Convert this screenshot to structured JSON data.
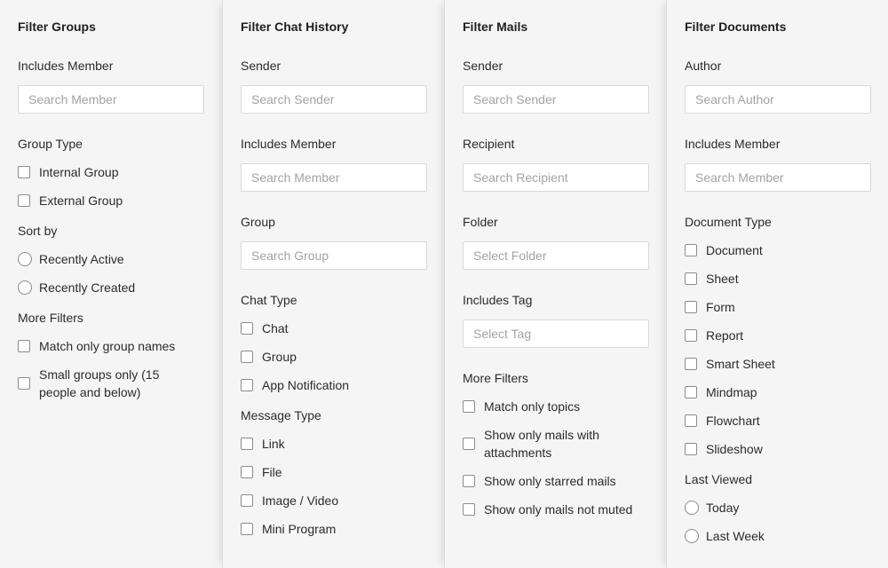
{
  "groups": {
    "title": "Filter Groups",
    "member_label": "Includes Member",
    "member_placeholder": "Search Member",
    "type_label": "Group Type",
    "type_options": [
      "Internal Group",
      "External Group"
    ],
    "sort_label": "Sort by",
    "sort_options": [
      "Recently Active",
      "Recently Created"
    ],
    "more_label": "More Filters",
    "more_options": [
      "Match only group names",
      "Small groups only (15 people and below)"
    ]
  },
  "chat": {
    "title": "Filter Chat History",
    "sender_label": "Sender",
    "sender_placeholder": "Search Sender",
    "member_label": "Includes Member",
    "member_placeholder": "Search Member",
    "group_label": "Group",
    "group_placeholder": "Search Group",
    "chat_type_label": "Chat Type",
    "chat_type_options": [
      "Chat",
      "Group",
      "App Notification"
    ],
    "message_type_label": "Message Type",
    "message_type_options": [
      "Link",
      "File",
      "Image / Video",
      "Mini Program"
    ]
  },
  "mails": {
    "title": "Filter Mails",
    "sender_label": "Sender",
    "sender_placeholder": "Search Sender",
    "recipient_label": "Recipient",
    "recipient_placeholder": "Search Recipient",
    "folder_label": "Folder",
    "folder_placeholder": "Select Folder",
    "tag_label": "Includes Tag",
    "tag_placeholder": "Select Tag",
    "more_label": "More Filters",
    "more_options": [
      "Match only topics",
      "Show only mails with attachments",
      "Show only starred mails",
      "Show only mails not muted"
    ]
  },
  "documents": {
    "title": "Filter Documents",
    "author_label": "Author",
    "author_placeholder": "Search Author",
    "member_label": "Includes Member",
    "member_placeholder": "Search Member",
    "doc_type_label": "Document Type",
    "doc_type_options": [
      "Document",
      "Sheet",
      "Form",
      "Report",
      "Smart Sheet",
      "Mindmap",
      "Flowchart",
      "Slideshow"
    ],
    "last_viewed_label": "Last Viewed",
    "last_viewed_options": [
      "Today",
      "Last Week"
    ]
  }
}
